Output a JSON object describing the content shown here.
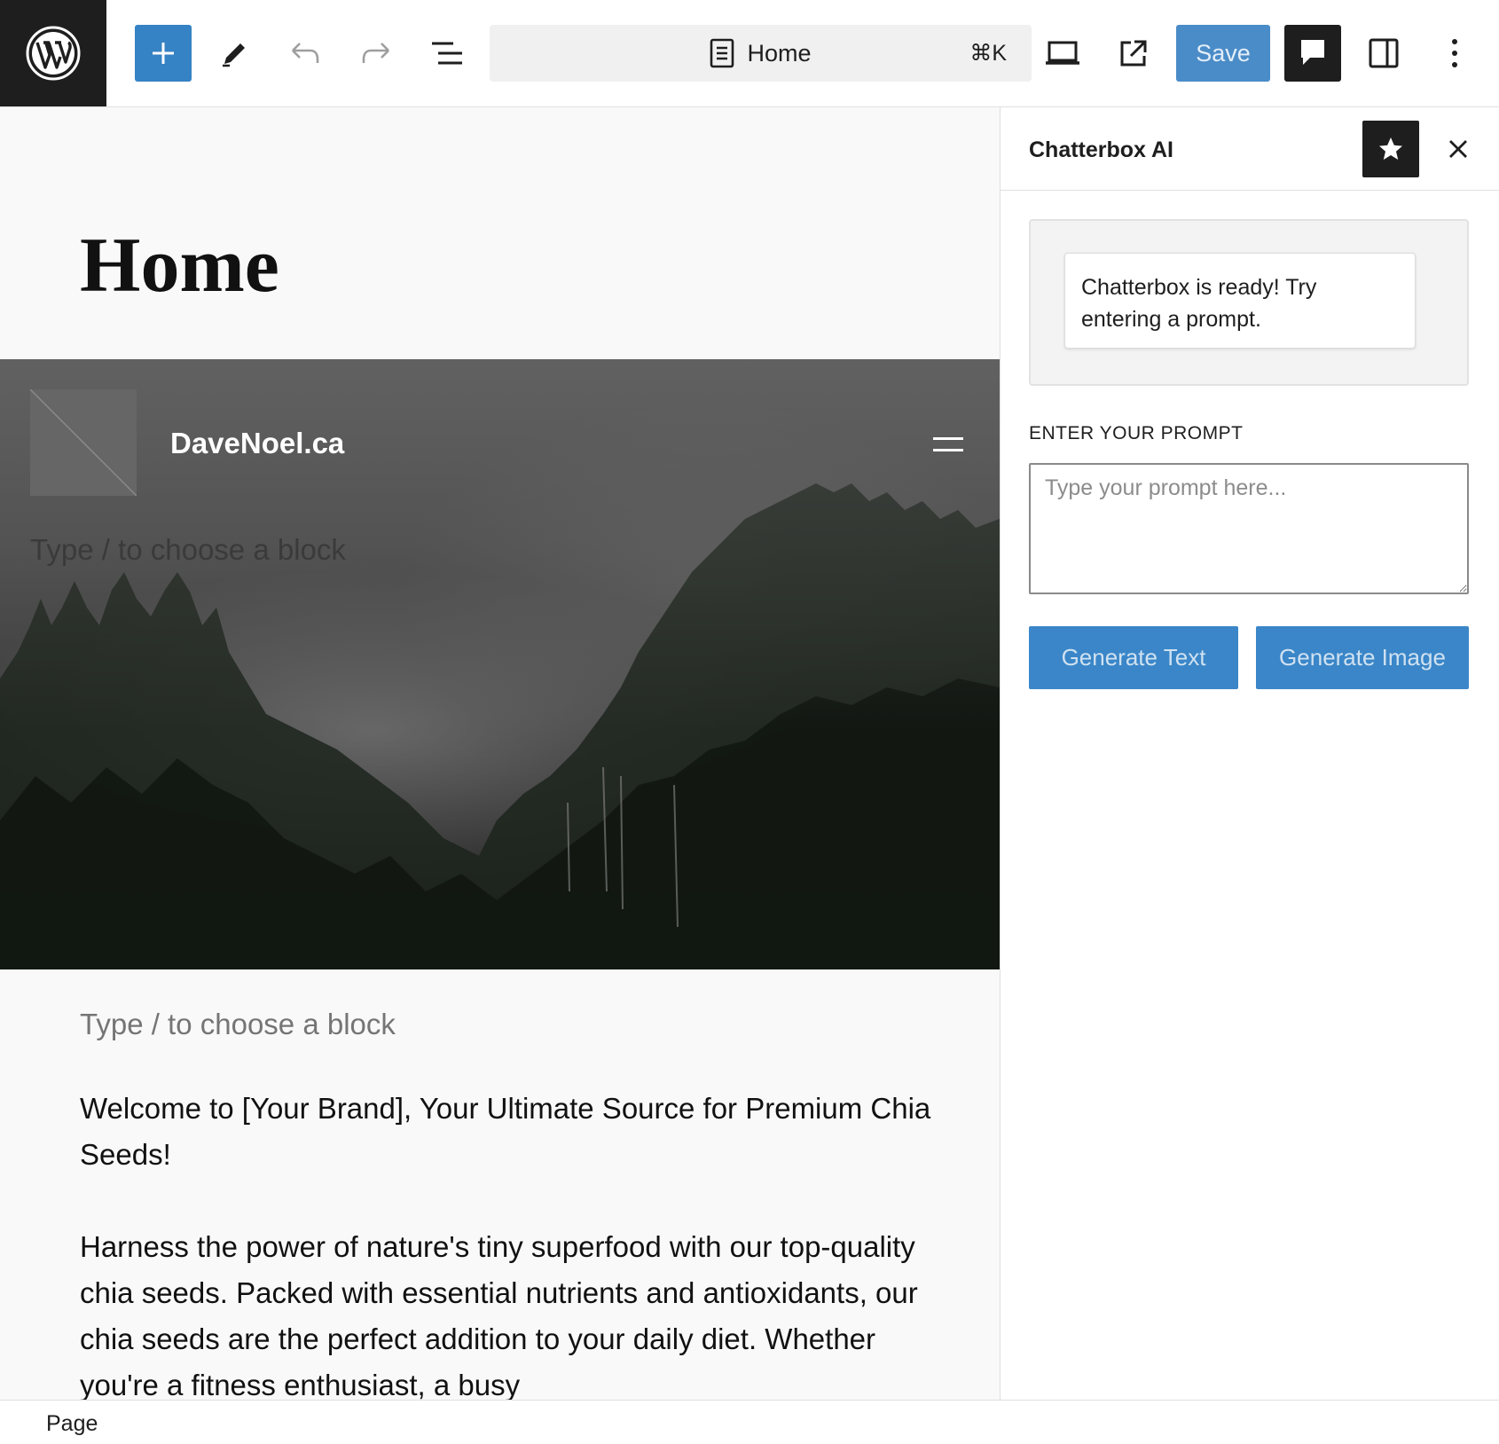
{
  "toolbar": {
    "document_title": "Home",
    "shortcut": "⌘K",
    "save_label": "Save",
    "icons": [
      "wordpress-icon",
      "plus-icon",
      "pencil-icon",
      "undo-icon",
      "redo-icon",
      "list-view-icon",
      "page-icon",
      "desktop-icon",
      "external-link-icon",
      "chat-icon",
      "sidebar-icon",
      "more-vertical-icon"
    ]
  },
  "editor": {
    "page_title": "Home",
    "site_name": "DaveNoel.ca",
    "cover_placeholder": "Type / to choose a block",
    "content_placeholder": "Type / to choose a block",
    "paragraphs": [
      "Welcome to [Your Brand], Your Ultimate Source for Premium Chia Seeds!",
      "Harness the power of nature's tiny superfood with our top-quality chia seeds. Packed with essential nutrients and antioxidants, our chia seeds are the perfect addition to your daily diet. Whether you're a fitness enthusiast, a busy"
    ]
  },
  "sidebar": {
    "title": "Chatterbox AI",
    "message": "Chatterbox is ready! Try entering a prompt.",
    "prompt_label": "ENTER YOUR PROMPT",
    "prompt_placeholder": "Type your prompt here...",
    "prompt_value": "",
    "generate_text_label": "Generate Text",
    "generate_image_label": "Generate Image"
  },
  "footer": {
    "breadcrumb": "Page"
  },
  "colors": {
    "accent": "#3582c4",
    "dark": "#1e1e1e",
    "canvas_bg": "#f9f9f9"
  }
}
